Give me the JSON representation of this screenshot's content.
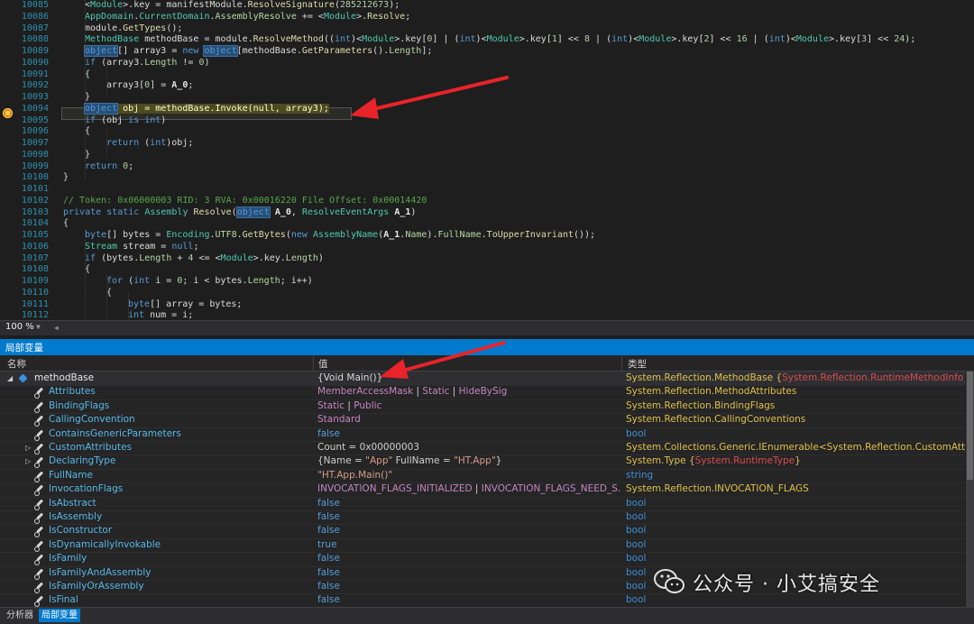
{
  "editor": {
    "lines": [
      {
        "no": "10085",
        "indent": 2,
        "parts": [
          [
            "p",
            "<"
          ],
          [
            "t",
            "Module"
          ],
          [
            "p",
            ">.key = manifestModule."
          ],
          [
            "m",
            "ResolveSignature"
          ],
          [
            "p",
            "("
          ],
          [
            "n",
            "285212673"
          ],
          [
            "p",
            ");"
          ]
        ]
      },
      {
        "no": "10086",
        "indent": 2,
        "parts": [
          [
            "t",
            "AppDomain"
          ],
          [
            "p",
            "."
          ],
          [
            "t",
            "CurrentDomain"
          ],
          [
            "p",
            "."
          ],
          [
            "f",
            "AssemblyResolve"
          ],
          [
            "p",
            " += <"
          ],
          [
            "t",
            "Module"
          ],
          [
            "p",
            ">."
          ],
          [
            "m",
            "Resolve"
          ],
          [
            "p",
            ";"
          ]
        ]
      },
      {
        "no": "10087",
        "indent": 2,
        "parts": [
          [
            "p",
            "module."
          ],
          [
            "m",
            "GetTypes"
          ],
          [
            "p",
            "();"
          ]
        ]
      },
      {
        "no": "10088",
        "indent": 2,
        "parts": [
          [
            "t",
            "MethodBase"
          ],
          [
            "p",
            " methodBase = module."
          ],
          [
            "m",
            "ResolveMethod"
          ],
          [
            "p",
            "(("
          ],
          [
            "k",
            "int"
          ],
          [
            "p",
            ")<"
          ],
          [
            "t",
            "Module"
          ],
          [
            "p",
            ">.key["
          ],
          [
            "n",
            "0"
          ],
          [
            "p",
            "] | ("
          ],
          [
            "k",
            "int"
          ],
          [
            "p",
            ")<"
          ],
          [
            "t",
            "Module"
          ],
          [
            "p",
            ">.key["
          ],
          [
            "n",
            "1"
          ],
          [
            "p",
            "] << "
          ],
          [
            "n",
            "8"
          ],
          [
            "p",
            " | ("
          ],
          [
            "k",
            "int"
          ],
          [
            "p",
            ")<"
          ],
          [
            "t",
            "Module"
          ],
          [
            "p",
            ">.key["
          ],
          [
            "n",
            "2"
          ],
          [
            "p",
            "] << "
          ],
          [
            "n",
            "16"
          ],
          [
            "p",
            " | ("
          ],
          [
            "k",
            "int"
          ],
          [
            "p",
            ")<"
          ],
          [
            "t",
            "Module"
          ],
          [
            "p",
            ">.key["
          ],
          [
            "n",
            "3"
          ],
          [
            "p",
            "] << "
          ],
          [
            "n",
            "24"
          ],
          [
            "p",
            ");"
          ]
        ]
      },
      {
        "no": "10089",
        "indent": 2,
        "parts": [
          [
            "ks",
            "object"
          ],
          [
            "p",
            "[] array3 = "
          ],
          [
            "k",
            "new "
          ],
          [
            "ks",
            "object"
          ],
          [
            "p",
            "[methodBase."
          ],
          [
            "m",
            "GetParameters"
          ],
          [
            "p",
            "()."
          ],
          [
            "f",
            "Length"
          ],
          [
            "p",
            "];"
          ]
        ]
      },
      {
        "no": "10090",
        "indent": 2,
        "parts": [
          [
            "k",
            "if"
          ],
          [
            "p",
            " (array3."
          ],
          [
            "f",
            "Length"
          ],
          [
            "p",
            " != "
          ],
          [
            "n",
            "0"
          ],
          [
            "p",
            ")"
          ]
        ]
      },
      {
        "no": "10091",
        "indent": 2,
        "parts": [
          [
            "p",
            "{"
          ]
        ]
      },
      {
        "no": "10092",
        "indent": 3,
        "parts": [
          [
            "p",
            "array3["
          ],
          [
            "n",
            "0"
          ],
          [
            "p",
            "] = "
          ],
          [
            "v",
            "A_0"
          ],
          [
            "p",
            ";"
          ]
        ]
      },
      {
        "no": "10093",
        "indent": 2,
        "parts": [
          [
            "p",
            "}"
          ]
        ]
      },
      {
        "no": "10094",
        "indent": 2,
        "parts": [
          [
            "hs",
            "object"
          ],
          [
            "h",
            " obj = methodBase.Invoke(null, array3);"
          ]
        ]
      },
      {
        "no": "10095",
        "indent": 2,
        "parts": [
          [
            "k",
            "if"
          ],
          [
            "p",
            " (obj "
          ],
          [
            "k",
            "is int"
          ],
          [
            "p",
            ")"
          ]
        ]
      },
      {
        "no": "10096",
        "indent": 2,
        "parts": [
          [
            "p",
            "{"
          ]
        ]
      },
      {
        "no": "10097",
        "indent": 3,
        "parts": [
          [
            "k",
            "return"
          ],
          [
            "p",
            " ("
          ],
          [
            "k",
            "int"
          ],
          [
            "p",
            ")obj;"
          ]
        ]
      },
      {
        "no": "10098",
        "indent": 2,
        "parts": [
          [
            "p",
            "}"
          ]
        ]
      },
      {
        "no": "10099",
        "indent": 2,
        "parts": [
          [
            "k",
            "return"
          ],
          [
            "p",
            " "
          ],
          [
            "n",
            "0"
          ],
          [
            "p",
            ";"
          ]
        ]
      },
      {
        "no": "10100",
        "indent": 1,
        "parts": [
          [
            "p",
            "}"
          ]
        ]
      },
      {
        "no": "10101",
        "indent": 0,
        "parts": []
      },
      {
        "no": "10102",
        "indent": 1,
        "parts": [
          [
            "c",
            "// Token: 0x06000003 RID: 3 RVA: 0x00016220 File Offset: 0x00014420"
          ]
        ]
      },
      {
        "no": "10103",
        "indent": 1,
        "parts": [
          [
            "k",
            "private static "
          ],
          [
            "t",
            "Assembly"
          ],
          [
            "p",
            " "
          ],
          [
            "m",
            "Resolve"
          ],
          [
            "p",
            "("
          ],
          [
            "ks",
            "object"
          ],
          [
            "p",
            " "
          ],
          [
            "v",
            "A_0"
          ],
          [
            "p",
            ", "
          ],
          [
            "t",
            "ResolveEventArgs"
          ],
          [
            "p",
            " "
          ],
          [
            "v",
            "A_1"
          ],
          [
            "p",
            ")"
          ]
        ]
      },
      {
        "no": "10104",
        "indent": 1,
        "parts": [
          [
            "p",
            "{"
          ]
        ]
      },
      {
        "no": "10105",
        "indent": 2,
        "parts": [
          [
            "k",
            "byte"
          ],
          [
            "p",
            "[] bytes = "
          ],
          [
            "t",
            "Encoding"
          ],
          [
            "p",
            "."
          ],
          [
            "f",
            "UTF8"
          ],
          [
            "p",
            "."
          ],
          [
            "m",
            "GetBytes"
          ],
          [
            "p",
            "("
          ],
          [
            "k",
            "new "
          ],
          [
            "t",
            "AssemblyName"
          ],
          [
            "p",
            "("
          ],
          [
            "v",
            "A_1"
          ],
          [
            "p",
            "."
          ],
          [
            "f",
            "Name"
          ],
          [
            "p",
            ")."
          ],
          [
            "f",
            "FullName"
          ],
          [
            "p",
            "."
          ],
          [
            "m",
            "ToUpperInvariant"
          ],
          [
            "p",
            "());"
          ]
        ]
      },
      {
        "no": "10106",
        "indent": 2,
        "parts": [
          [
            "t",
            "Stream"
          ],
          [
            "p",
            " stream = "
          ],
          [
            "k",
            "null"
          ],
          [
            "p",
            ";"
          ]
        ]
      },
      {
        "no": "10107",
        "indent": 2,
        "parts": [
          [
            "k",
            "if"
          ],
          [
            "p",
            " (bytes."
          ],
          [
            "f",
            "Length"
          ],
          [
            "p",
            " + "
          ],
          [
            "n",
            "4"
          ],
          [
            "p",
            " <= <"
          ],
          [
            "t",
            "Module"
          ],
          [
            "p",
            ">.key."
          ],
          [
            "f",
            "Length"
          ],
          [
            "p",
            ")"
          ]
        ]
      },
      {
        "no": "10108",
        "indent": 2,
        "parts": [
          [
            "p",
            "{"
          ]
        ]
      },
      {
        "no": "10109",
        "indent": 3,
        "parts": [
          [
            "k",
            "for"
          ],
          [
            "p",
            " ("
          ],
          [
            "k",
            "int"
          ],
          [
            "p",
            " i = "
          ],
          [
            "n",
            "0"
          ],
          [
            "p",
            "; i < bytes."
          ],
          [
            "f",
            "Length"
          ],
          [
            "p",
            "; i++)"
          ]
        ]
      },
      {
        "no": "10110",
        "indent": 3,
        "parts": [
          [
            "p",
            "{"
          ]
        ]
      },
      {
        "no": "10111",
        "indent": 4,
        "parts": [
          [
            "k",
            "byte"
          ],
          [
            "p",
            "[] array = bytes;"
          ]
        ]
      },
      {
        "no": "10112",
        "indent": 4,
        "parts": [
          [
            "k",
            "int"
          ],
          [
            "p",
            " num = i;"
          ]
        ]
      }
    ],
    "zoom": "100 %"
  },
  "locals": {
    "title": "局部变量",
    "columns": {
      "name": "名称",
      "value": "值",
      "type": "类型"
    },
    "rows": [
      {
        "name": "methodBase",
        "value": "{Void Main()}",
        "type": [
          [
            "t",
            "System.Reflection."
          ],
          [
            "tc",
            "MethodBase"
          ],
          [
            "t",
            " {"
          ],
          [
            "tr",
            "System.Reflection.RuntimeMethodInfo"
          ],
          [
            "t",
            "}"
          ]
        ],
        "icon": "object",
        "expander": "▲",
        "first": true
      },
      {
        "name": "Attributes",
        "value": [
          [
            "v",
            "MemberAccessMask"
          ],
          [
            "w",
            " | "
          ],
          [
            "v",
            "Static"
          ],
          [
            "w",
            " | "
          ],
          [
            "v",
            "HideBySig"
          ]
        ],
        "type": [
          [
            "t",
            "System.Reflection."
          ],
          [
            "t",
            "MethodAttributes"
          ]
        ],
        "icon": "wrench"
      },
      {
        "name": "BindingFlags",
        "value": [
          [
            "v",
            "Static"
          ],
          [
            "w",
            " | "
          ],
          [
            "v",
            "Public"
          ]
        ],
        "type": [
          [
            "t",
            "System.Reflection."
          ],
          [
            "t",
            "BindingFlags"
          ]
        ],
        "icon": "wrench"
      },
      {
        "name": "CallingConvention",
        "value": [
          [
            "v",
            "Standard"
          ]
        ],
        "type": [
          [
            "t",
            "System.Reflection."
          ],
          [
            "t",
            "CallingConventions"
          ]
        ],
        "icon": "wrench"
      },
      {
        "name": "ContainsGenericParameters",
        "value": [
          [
            "k",
            "false"
          ]
        ],
        "type": [
          [
            "k",
            "bool"
          ]
        ],
        "icon": "wrench"
      },
      {
        "name": "CustomAttributes",
        "value": [
          [
            "w",
            "Count = 0x00000003"
          ]
        ],
        "type": [
          [
            "t",
            "System.Collections.Generic.IEnumerable<System.Reflection.CustomAttrib..."
          ]
        ],
        "icon": "wrench",
        "expander": "▶"
      },
      {
        "name": "DeclaringType",
        "value": [
          [
            "w",
            "{Name = "
          ],
          [
            "s",
            "\"App\""
          ],
          [
            "w",
            " FullName = "
          ],
          [
            "s",
            "\"HT.App\""
          ],
          [
            "w",
            "}"
          ]
        ],
        "type": [
          [
            "t",
            "System."
          ],
          [
            "t",
            "Type {"
          ],
          [
            "tr",
            "System.RuntimeType"
          ],
          [
            "t",
            "}"
          ]
        ],
        "icon": "wrench",
        "expander": "▶"
      },
      {
        "name": "FullName",
        "value": [
          [
            "s",
            "\"HT.App.Main()\""
          ]
        ],
        "type": [
          [
            "k",
            "string"
          ]
        ],
        "icon": "wrench"
      },
      {
        "name": "InvocationFlags",
        "value": [
          [
            "v",
            "INVOCATION_FLAGS_INITIALIZED"
          ],
          [
            "w",
            " | "
          ],
          [
            "v",
            "INVOCATION_FLAGS_NEED_S..."
          ]
        ],
        "type": [
          [
            "t",
            "System.Reflection.INVOCATION_FLAGS"
          ]
        ],
        "icon": "wrench"
      },
      {
        "name": "IsAbstract",
        "value": [
          [
            "k",
            "false"
          ]
        ],
        "type": [
          [
            "k",
            "bool"
          ]
        ],
        "icon": "wrench"
      },
      {
        "name": "IsAssembly",
        "value": [
          [
            "k",
            "false"
          ]
        ],
        "type": [
          [
            "k",
            "bool"
          ]
        ],
        "icon": "wrench"
      },
      {
        "name": "IsConstructor",
        "value": [
          [
            "k",
            "false"
          ]
        ],
        "type": [
          [
            "k",
            "bool"
          ]
        ],
        "icon": "wrench"
      },
      {
        "name": "IsDynamicallyInvokable",
        "value": [
          [
            "k",
            "true"
          ]
        ],
        "type": [
          [
            "k",
            "bool"
          ]
        ],
        "icon": "wrench"
      },
      {
        "name": "IsFamily",
        "value": [
          [
            "k",
            "false"
          ]
        ],
        "type": [
          [
            "k",
            "bool"
          ]
        ],
        "icon": "wrench"
      },
      {
        "name": "IsFamilyAndAssembly",
        "value": [
          [
            "k",
            "false"
          ]
        ],
        "type": [
          [
            "k",
            "bool"
          ]
        ],
        "icon": "wrench"
      },
      {
        "name": "IsFamilyOrAssembly",
        "value": [
          [
            "k",
            "false"
          ]
        ],
        "type": [
          [
            "k",
            "bool"
          ]
        ],
        "icon": "wrench"
      },
      {
        "name": "IsFinal",
        "value": [
          [
            "k",
            "false"
          ]
        ],
        "type": [
          [
            "k",
            "bool"
          ]
        ],
        "icon": "wrench"
      }
    ]
  },
  "bottom_tabs": [
    {
      "label": "分析器",
      "active": false
    },
    {
      "label": "局部变量",
      "active": true
    }
  ],
  "watermark": "公众号 · 小艾搞安全",
  "colors": {
    "accent": "#007acc",
    "arrow": "#e8232a",
    "breakpoint": "#e6761f"
  }
}
